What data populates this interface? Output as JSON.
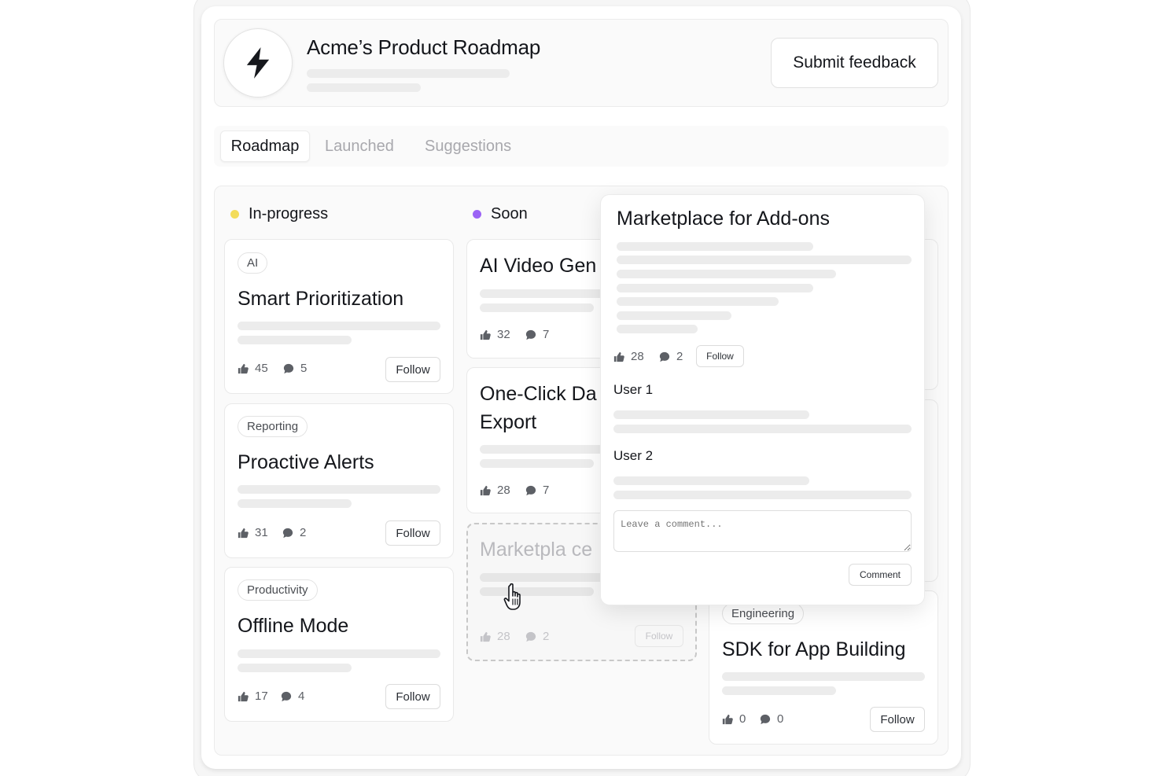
{
  "header": {
    "title": "Acme’s Product Roadmap",
    "submit_label": "Submit feedback",
    "logo_icon": "lightning-bolt-icon"
  },
  "tabs": [
    {
      "label": "Roadmap",
      "active": true
    },
    {
      "label": "Launched",
      "active": false
    },
    {
      "label": "Suggestions",
      "active": false
    }
  ],
  "colors": {
    "in_progress": "#f3dc5a",
    "soon": "#9b63f5",
    "accent_text": "#14161b"
  },
  "columns": {
    "in_progress": {
      "label": "In-progress",
      "cards": [
        {
          "tag": "AI",
          "title": "Smart Prioritization",
          "votes": "45",
          "comments": "5",
          "follow": "Follow"
        },
        {
          "tag": "Reporting",
          "title": "Proactive Alerts",
          "votes": "31",
          "comments": "2",
          "follow": "Follow"
        },
        {
          "tag": "Productivity",
          "title": "Offline Mode",
          "votes": "17",
          "comments": "4",
          "follow": "Follow"
        }
      ]
    },
    "soon": {
      "label": "Soon",
      "cards": [
        {
          "title": "AI Video Gen",
          "votes": "32",
          "comments": "7"
        },
        {
          "title": "One-Click Da Export",
          "title_line1": "One-Click Da",
          "title_line2": "Export",
          "votes": "28",
          "comments": "7"
        }
      ],
      "dragging": {
        "title": "Marketpla ce",
        "votes": "28",
        "comments": "2",
        "follow": "Follow"
      }
    },
    "third": {
      "cards": [
        {
          "tag": "Engineering",
          "title": "SDK for App Building",
          "votes": "0",
          "comments": "0",
          "follow": "Follow"
        }
      ]
    }
  },
  "popover": {
    "title": "Marketplace for Add-ons",
    "votes": "28",
    "comments": "2",
    "follow": "Follow",
    "users": [
      "User 1",
      "User 2"
    ],
    "comment_placeholder": "Leave a comment...",
    "comment_button": "Comment"
  }
}
